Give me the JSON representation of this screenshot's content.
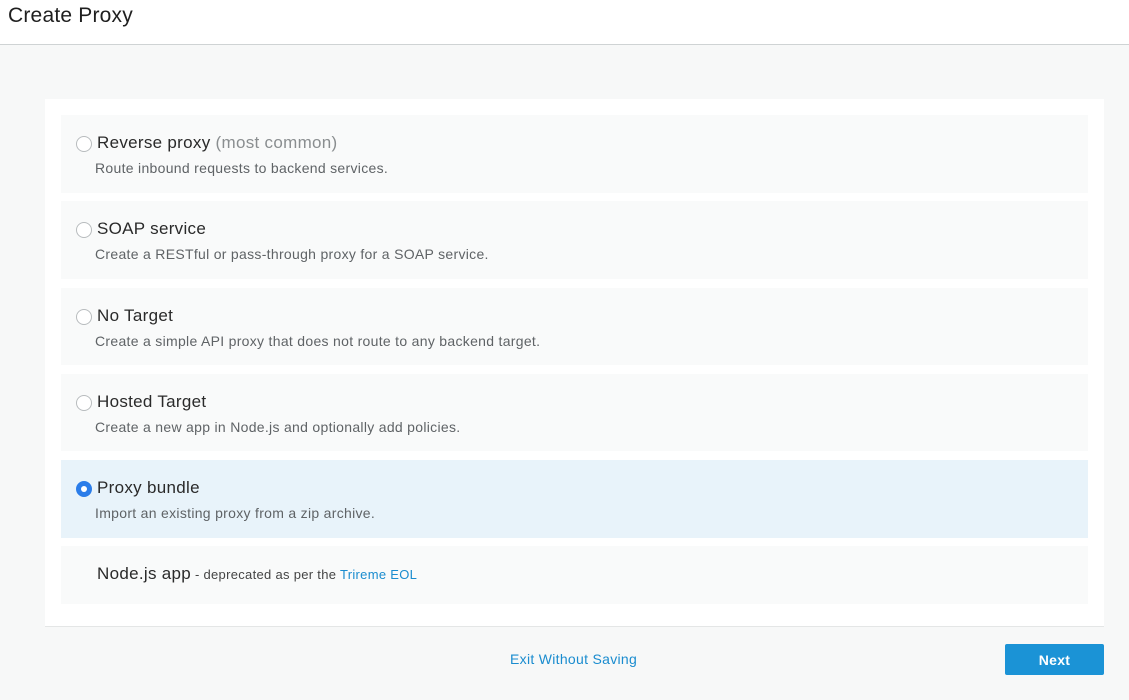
{
  "header": {
    "title": "Create Proxy"
  },
  "options": [
    {
      "title": "Reverse proxy",
      "note": "(most common)",
      "description": "Route inbound requests to backend services.",
      "selected": false
    },
    {
      "title": "SOAP service",
      "description": "Create a RESTful or pass-through proxy for a SOAP service.",
      "selected": false
    },
    {
      "title": "No Target",
      "description": "Create a simple API proxy that does not route to any backend target.",
      "selected": false
    },
    {
      "title": "Hosted Target",
      "description": "Create a new app in Node.js and optionally add policies.",
      "selected": false
    },
    {
      "title": "Proxy bundle",
      "description": "Import an existing proxy from a zip archive.",
      "selected": true
    }
  ],
  "nodejs": {
    "title": "Node.js app",
    "note": " - deprecated as per the ",
    "link": "Trireme EOL"
  },
  "footer": {
    "exit_label": "Exit Without Saving",
    "next_label": "Next"
  },
  "colors": {
    "accent": "#1b93d6",
    "selected_bg": "#e8f3fa",
    "link": "#1a8ccf"
  }
}
